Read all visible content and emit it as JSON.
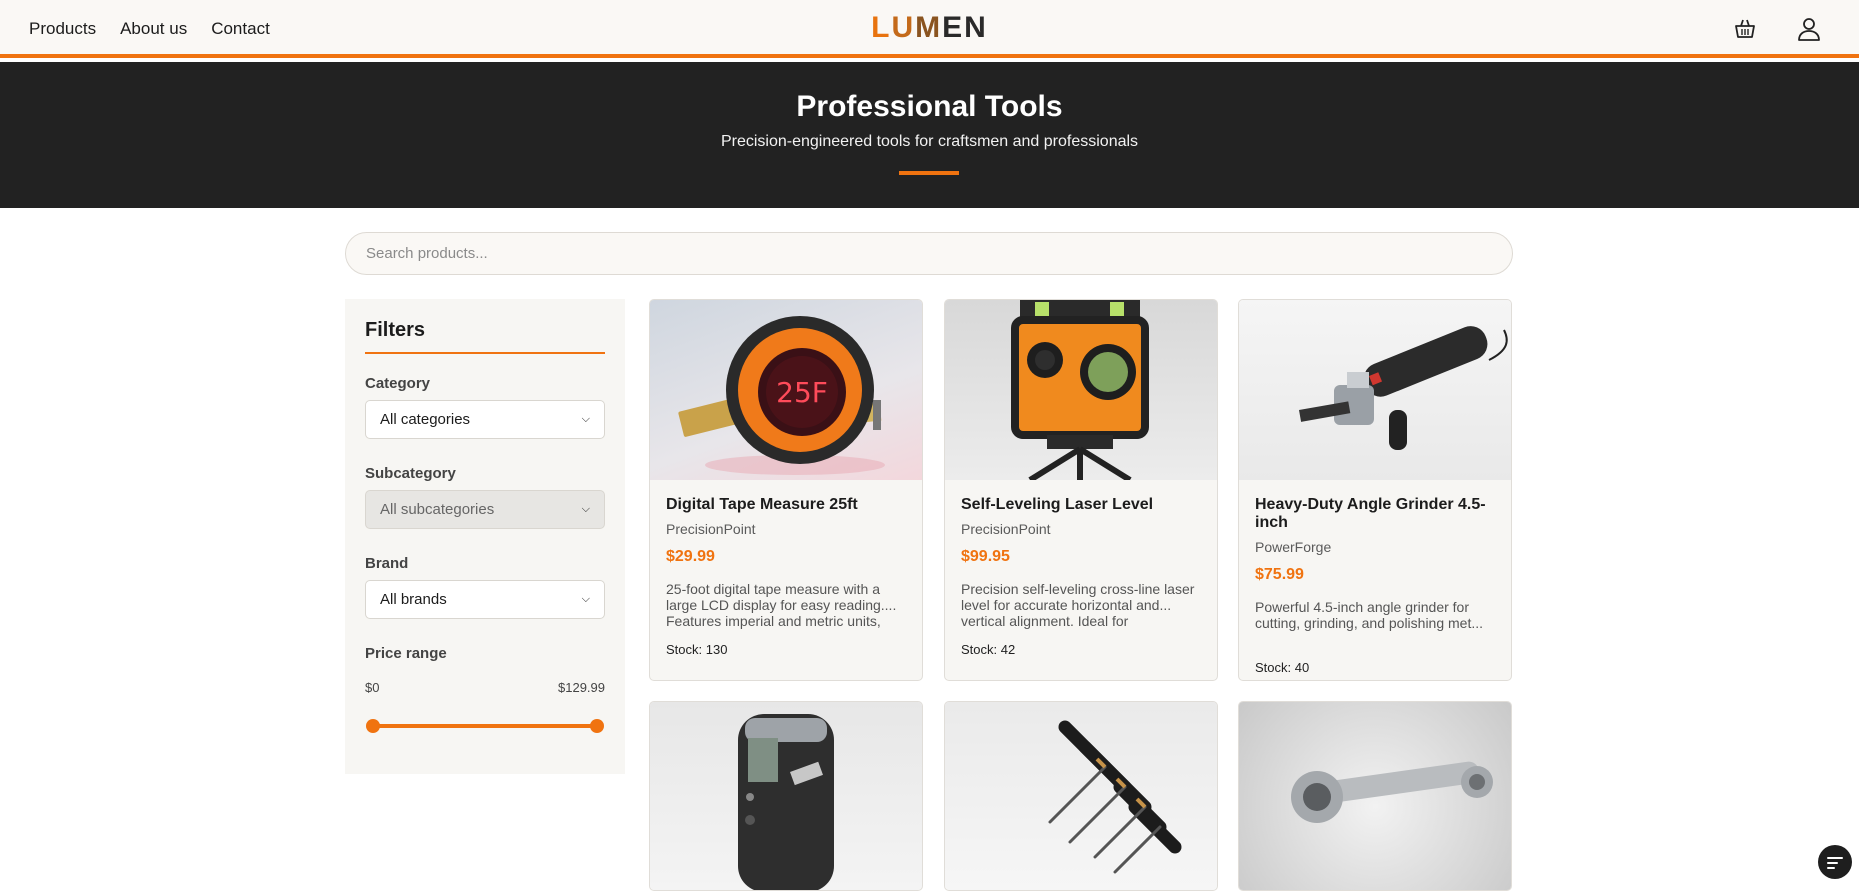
{
  "header": {
    "nav": [
      "Products",
      "About us",
      "Contact"
    ],
    "logo": "LUMEN",
    "icons": [
      "basket-icon",
      "user-icon"
    ]
  },
  "hero": {
    "title": "Professional Tools",
    "subtitle": "Precision-engineered tools for craftsmen and professionals"
  },
  "search": {
    "placeholder": "Search products..."
  },
  "filters": {
    "title": "Filters",
    "category": {
      "label": "Category",
      "value": "All categories"
    },
    "subcategory": {
      "label": "Subcategory",
      "value": "All subcategories"
    },
    "brand": {
      "label": "Brand",
      "value": "All brands"
    },
    "price": {
      "label": "Price range",
      "min": "$0",
      "max": "$129.99"
    }
  },
  "products": [
    {
      "name": "Digital Tape Measure 25ft",
      "brand": "PrecisionPoint",
      "price": "$29.99",
      "description": "25-foot digital tape measure with a large LCD display for easy reading.... Features imperial and metric units,",
      "stock": "Stock: 130",
      "image_text": "25F"
    },
    {
      "name": "Self-Leveling Laser Level",
      "brand": "PrecisionPoint",
      "price": "$99.95",
      "description": "Precision self-leveling cross-line laser level for accurate horizontal and... vertical alignment. Ideal for",
      "stock": "Stock: 42"
    },
    {
      "name": "Heavy-Duty Angle Grinder 4.5-inch",
      "brand": "PowerForge",
      "price": "$75.99",
      "description": "Powerful 4.5-inch angle grinder for cutting, grinding, and polishing met...",
      "stock": "Stock: 40"
    },
    {},
    {},
    {}
  ],
  "colors": {
    "accent": "#f07310",
    "hero_bg": "#222222"
  }
}
